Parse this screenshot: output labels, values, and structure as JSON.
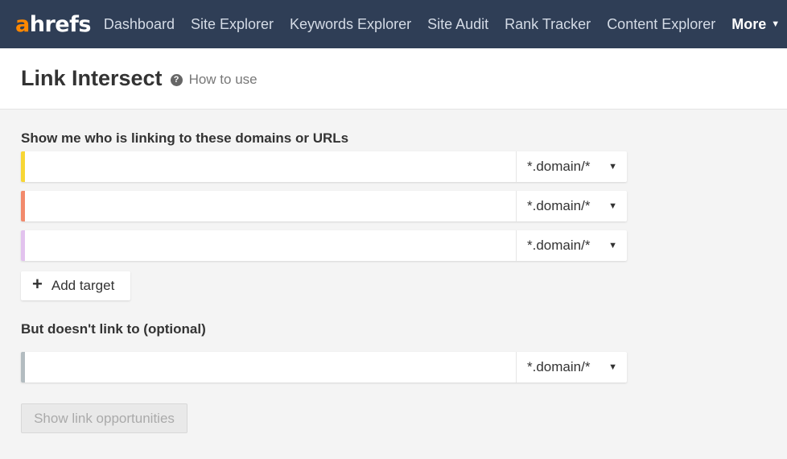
{
  "nav": {
    "logo_a": "a",
    "logo_rest": "hrefs",
    "items": [
      "Dashboard",
      "Site Explorer",
      "Keywords Explorer",
      "Site Audit",
      "Rank Tracker",
      "Content Explorer"
    ],
    "more": "More"
  },
  "header": {
    "title": "Link Intersect",
    "help_glyph": "?",
    "how_to_use": "How to use"
  },
  "form": {
    "linking_label": "Show me who is linking to these domains or URLs",
    "targets": [
      {
        "value": "",
        "mode": "*.domain/*",
        "color": "#f7d635"
      },
      {
        "value": "",
        "mode": "*.domain/*",
        "color": "#f28a6c"
      },
      {
        "value": "",
        "mode": "*.domain/*",
        "color": "#e2c2ee"
      }
    ],
    "add_target": "Add target",
    "exclude_label": "But doesn't link to (optional)",
    "exclude": {
      "value": "",
      "mode": "*.domain/*",
      "color": "#b3bcc0"
    },
    "submit": "Show link opportunities"
  }
}
